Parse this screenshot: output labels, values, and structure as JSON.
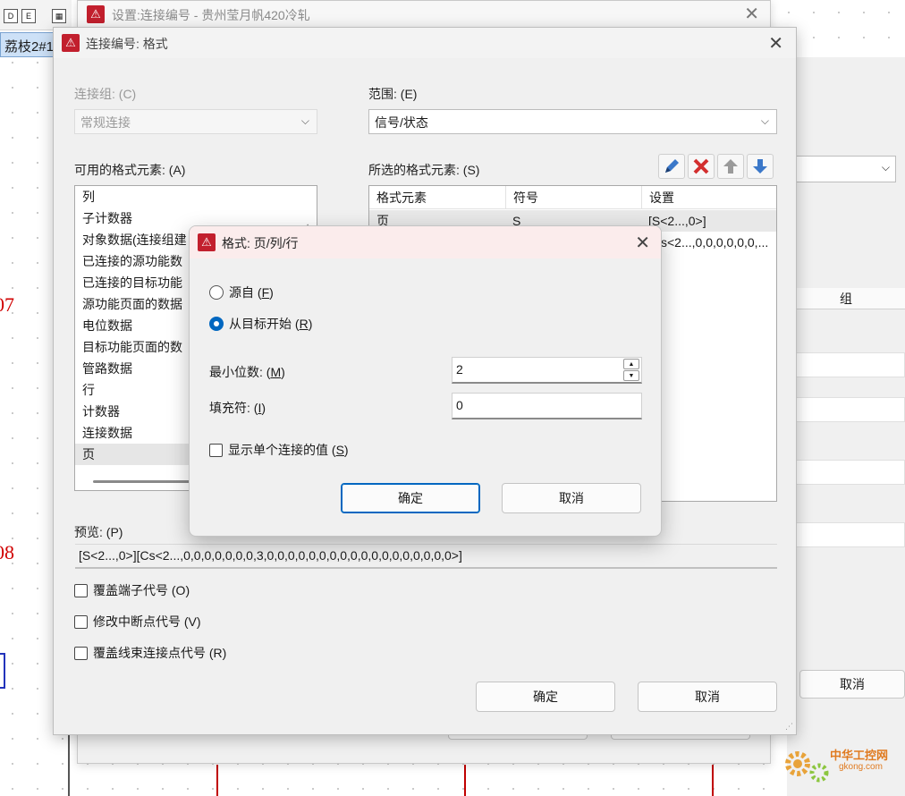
{
  "background": {
    "tab_label": "荔枝2#1",
    "markers": [
      "07",
      "08"
    ],
    "right_window": {
      "column_header": "组",
      "cancel_label": "取消"
    }
  },
  "outer_dialog": {
    "title": "设置:连接编号 - 贵州莹月帆420冷轧"
  },
  "main_dialog": {
    "title": "连接编号: 格式",
    "connection_group_label": "连接组: (C)",
    "connection_group_value": "常规连接",
    "scope_label": "范围: (E)",
    "scope_value": "信号/状态",
    "available_label": "可用的格式元素: (A)",
    "available_items": [
      "列",
      "子计数器",
      "对象数据(连接组建",
      "已连接的源功能数",
      "已连接的目标功能",
      "源功能页面的数据",
      "电位数据",
      "目标功能页面的数",
      "管路数据",
      "行",
      "计数器",
      "连接数据",
      "页"
    ],
    "selected_index": 12,
    "selected_label": "所选的格式元素: (S)",
    "table_headers": [
      "格式元素",
      "符号",
      "设置"
    ],
    "table_rows": [
      [
        "页",
        "S",
        "[S<2...,0>]"
      ],
      [
        "",
        "",
        "[Cs<2...,0,0,0,0,0,0,..."
      ]
    ],
    "preview_label": "预览: (P)",
    "preview_value": "[S<2...,0>][Cs<2...,0,0,0,0,0,0,0,3,0,0,0,0,0,0,0,0,0,0,0,0,0,0,0,0,0,0>]",
    "checkboxes": [
      "覆盖端子代号 (O)",
      "修改中断点代号 (V)",
      "覆盖线束连接点代号 (R)"
    ],
    "ok_label": "确定",
    "cancel_label": "取消"
  },
  "format_dialog": {
    "title": "格式: 页/列/行",
    "radio_source": "源自",
    "radio_source_key": "F",
    "radio_target": "从目标开始",
    "radio_target_key": "R",
    "min_digits_label": "最小位数:",
    "min_digits_key": "M",
    "min_digits_value": "2",
    "fill_char_label": "填充符:",
    "fill_char_key": "I",
    "fill_char_value": "0",
    "show_single_label": "显示单个连接的值",
    "show_single_key": "S",
    "ok_label": "确定",
    "cancel_label": "取消"
  },
  "watermark": {
    "name": "中华工控网",
    "domain": "gkong.com"
  },
  "colors": {
    "accent": "#0067c0",
    "delete": "#d32f2f",
    "arrow": "#3b78c9",
    "marker": "#d00000"
  }
}
